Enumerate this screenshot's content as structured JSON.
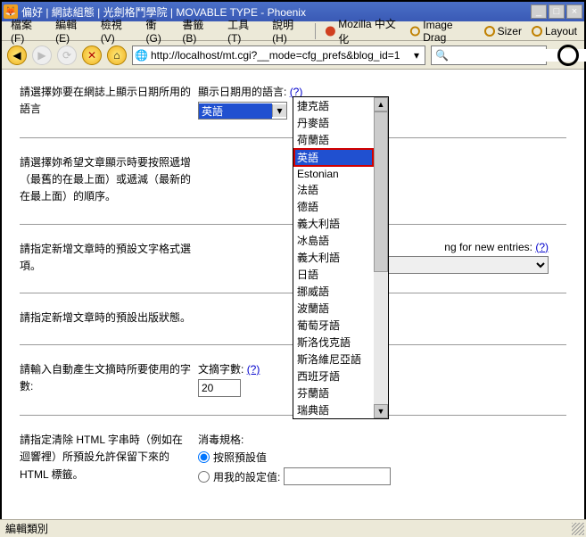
{
  "window": {
    "title": "偏好 | 網誌組態 | 光劍格鬥學院 | MOVABLE TYPE - Phoenix",
    "min": "_",
    "max": "□",
    "close": "×"
  },
  "menu": {
    "file": "檔案(F)",
    "edit": "編輯(E)",
    "view": "檢視(V)",
    "go": "衝(G)",
    "bookmarks": "書籤(B)",
    "tools": "工具(T)",
    "help": "說明(H)",
    "mozilla_cn": "Mozilla 中文化",
    "image_drag": "Image Drag",
    "sizer": "Sizer",
    "layout": "Layout"
  },
  "toolbar": {
    "back": "◀",
    "fwd": "▶",
    "reload": "⟳",
    "stop": "✕",
    "home": "⌂",
    "url": "http://localhost/mt.cgi?__mode=cfg_prefs&blog_id=1",
    "url_proto_icon": "🌐",
    "drop": "▾",
    "search_icon": "🔍"
  },
  "rows": {
    "r1": {
      "left": "請選擇妳要在網誌上顯示日期所用的語言",
      "label": "顯示日期用的語言:",
      "help": "(?)",
      "selected": "英語"
    },
    "r2": {
      "left": "請選擇妳希望文章顯示時要按照遞增（最舊的在最上面）或遞減（最新的在最上面）的順序。"
    },
    "r3": {
      "left": "請指定新增文章時的預設文字格式選項。",
      "label_tail": "ng for new entries:",
      "help": "(?)"
    },
    "r4": {
      "left": "請指定新增文章時的預設出版狀態。"
    },
    "r5": {
      "left": "請輸入自動產生文摘時所要使用的字數:",
      "label": "文摘字數:",
      "help": "(?)",
      "value": "20"
    },
    "r6": {
      "left": "請指定清除 HTML 字串時（例如在迴響裡）所預設允許保留下來的 HTML 標籤。",
      "label": "消毒規格:",
      "opt1": "按照預設值",
      "opt2": "用我的設定值:"
    }
  },
  "dropdown": {
    "items": [
      "捷克語",
      "丹麥語",
      "荷蘭語",
      "英語",
      "Estonian",
      "法語",
      "德語",
      "義大利語",
      "冰島語",
      "義大利語",
      "日語",
      "挪威語",
      "波蘭語",
      "葡萄牙語",
      "斯洛伐克語",
      "斯洛維尼亞語",
      "西班牙語",
      "芬蘭語",
      "瑞典語"
    ],
    "highlight_index": 3,
    "up": "▲",
    "down": "▼"
  },
  "status": {
    "text": "編輯類別"
  }
}
